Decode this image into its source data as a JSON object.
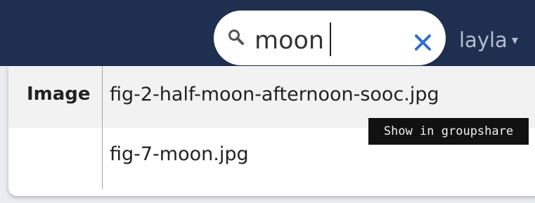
{
  "search": {
    "value": "moon",
    "icon": "search-icon",
    "clear_icon": "close-icon"
  },
  "user_menu": {
    "username": "layla",
    "caret": "▾"
  },
  "dropdown": {
    "category": "Image",
    "results": [
      {
        "label": "fig-2-half-moon-afternoon-sooc.jpg"
      },
      {
        "label": "fig-7-moon.jpg"
      }
    ]
  },
  "tooltip": {
    "text": "Show in groupshare"
  },
  "colors": {
    "topbar": "#1f2f4f",
    "accent": "#2f6fd1",
    "tooltip_bg": "#111111"
  }
}
